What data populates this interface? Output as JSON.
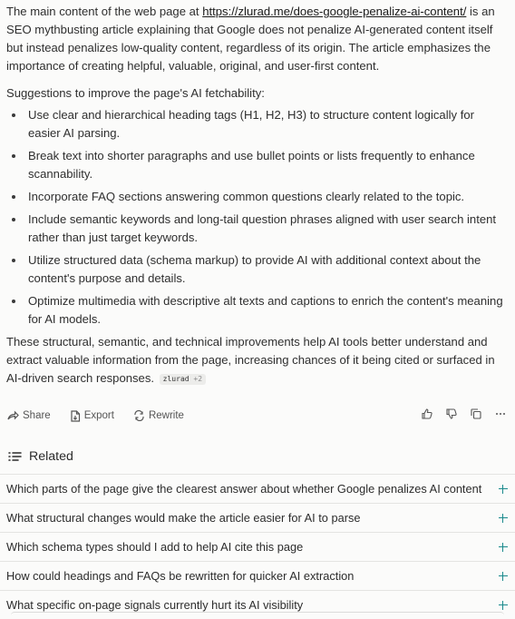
{
  "answer": {
    "intro_prefix": "The main content of the web page at ",
    "intro_link": "https://zlurad.me/does-google-penalize-ai-content/",
    "intro_suffix": " is an SEO mythbusting article explaining that Google does not penalize AI-generated content itself but instead penalizes low-quality content, regardless of its origin. The article emphasizes the importance of creating helpful, valuable, original, and user-first content.",
    "suggestions_title": "Suggestions to improve the page's AI fetchability:",
    "bullets": [
      "Use clear and hierarchical heading tags (H1, H2, H3) to structure content logically for easier AI parsing.",
      "Break text into shorter paragraphs and use bullet points or lists frequently to enhance scannability.",
      "Incorporate FAQ sections answering common questions clearly related to the topic.",
      "Include semantic keywords and long-tail question phrases aligned with user search intent rather than just target keywords.",
      "Utilize structured data (schema markup) to provide AI with additional context about the content's purpose and details.",
      "Optimize multimedia with descriptive alt texts and captions to enrich the content's meaning for AI models."
    ],
    "closing": "These structural, semantic, and technical improvements help AI tools better understand and extract valuable information from the page, increasing chances of it being cited or surfaced in AI-driven search responses.",
    "citation": {
      "source": "zlurad",
      "more": "+2"
    }
  },
  "actions": {
    "share": "Share",
    "export": "Export",
    "rewrite": "Rewrite",
    "right_icons": [
      "thumbs-up-icon",
      "thumbs-down-icon",
      "copy-icon",
      "more-icon"
    ]
  },
  "related": {
    "title": "Related",
    "items": [
      "Which parts of the page give the clearest answer about whether Google penalizes AI content",
      "What structural changes would make the article easier for AI to parse",
      "Which schema types should I add to help AI cite this page",
      "How could headings and FAQs be rewritten for quicker AI extraction",
      "What specific on-page signals currently hurt its AI visibility"
    ]
  },
  "colors": {
    "accent": "#1a8a8c",
    "text": "#2f2f2f",
    "background": "#fbfbfa"
  }
}
